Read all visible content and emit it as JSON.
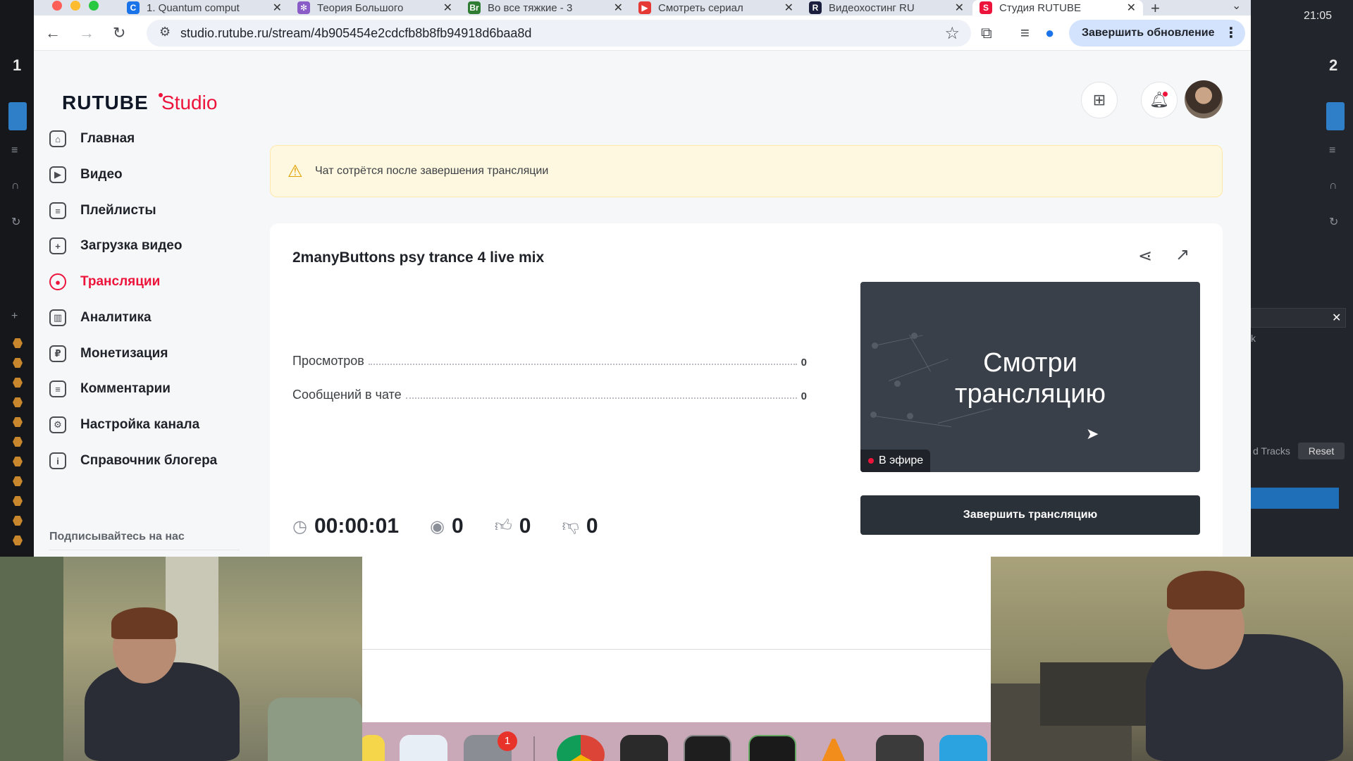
{
  "tabs": [
    {
      "title": "1. Quantum comput",
      "fav_color": "#1a73e8",
      "fav_glyph": "C"
    },
    {
      "title": "Теория Большого",
      "fav_color": "#8a5cc8",
      "fav_glyph": "✻"
    },
    {
      "title": "Во все тяжкие - 3",
      "fav_color": "#2e7d32",
      "fav_glyph": "Br"
    },
    {
      "title": "Смотреть сериал",
      "fav_color": "#e53935",
      "fav_glyph": "▶"
    },
    {
      "title": "Видеохостинг RU",
      "fav_color": "#1b1e3c",
      "fav_glyph": "R"
    },
    {
      "title": "Студия RUTUBE",
      "fav_color": "#ed143b",
      "fav_glyph": "S"
    }
  ],
  "toolbar": {
    "url": "studio.rutube.ru/stream/4b905454e2cdcfb8b8fb94918d6baa8d",
    "update_label": "Завершить обновление"
  },
  "logo": {
    "brand": "RUTUBE",
    "studio": "Studio"
  },
  "sidebar": {
    "items": [
      {
        "label": "Главная",
        "icon": "home-icon",
        "glyph": "⌂"
      },
      {
        "label": "Видео",
        "icon": "video-icon",
        "glyph": "▶"
      },
      {
        "label": "Плейлисты",
        "icon": "playlist-icon",
        "glyph": "≡"
      },
      {
        "label": "Загрузка видео",
        "icon": "upload-icon",
        "glyph": "+"
      },
      {
        "label": "Трансляции",
        "icon": "broadcast-icon",
        "glyph": "●"
      },
      {
        "label": "Аналитика",
        "icon": "analytics-icon",
        "glyph": "▥"
      },
      {
        "label": "Монетизация",
        "icon": "ruble-icon",
        "glyph": "₽"
      },
      {
        "label": "Комментарии",
        "icon": "comment-icon",
        "glyph": "≡"
      },
      {
        "label": "Настройка канала",
        "icon": "gear-icon",
        "glyph": "⚙"
      },
      {
        "label": "Справочник блогера",
        "icon": "info-icon",
        "glyph": "i"
      }
    ],
    "active_index": 4,
    "follow_label": "Подписывайтесь на нас"
  },
  "alert": {
    "text": "Чат сотрётся после завершения трансляции"
  },
  "stream": {
    "title": "2manyButtons psy trance 4 live mix",
    "stats": [
      {
        "label": "Просмотров",
        "value": "0"
      },
      {
        "label": "Сообщений в чате",
        "value": "0"
      }
    ],
    "duration": "00:00:01",
    "viewers": "0",
    "likes": "0",
    "dislikes": "0",
    "preview_text_line1": "Смотри",
    "preview_text_line2": "трансляцию",
    "live_label": "В эфире",
    "end_label": "Завершить трансляцию"
  },
  "dj": {
    "deck_left": "1",
    "deck_right": "2",
    "reset_label": "Reset",
    "tracks_label": "d Tracks",
    "col_label": "k"
  },
  "system": {
    "clock": "21:05",
    "dock_badge": "1"
  },
  "colors": {
    "accent": "#ed143b",
    "alert_bg": "#fff8e1",
    "button_dark": "#2b3139"
  }
}
